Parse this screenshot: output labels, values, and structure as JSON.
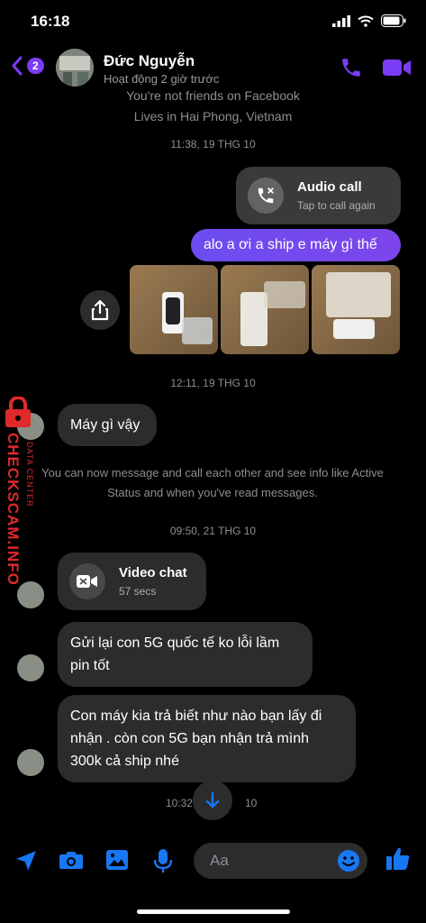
{
  "status": {
    "time": "16:18"
  },
  "header": {
    "back_badge": "2",
    "name": "Đức Nguyễn",
    "presence": "Hoạt động 2 giờ trước"
  },
  "profile_info": {
    "line1": "You're not friends on Facebook",
    "line2": "Lives in Hai Phong, Vietnam"
  },
  "timestamps": {
    "t1": "11:38, 19 THG 10",
    "t2": "12:11, 19 THG 10",
    "t3": "09:50, 21 THG 10",
    "t4": "10:32",
    "t4_suffix": "10"
  },
  "messages": {
    "audio_call_title": "Audio call",
    "audio_call_sub": "Tap to call again",
    "out_1": "alo a ơi a ship e máy gì thế",
    "in_1": "Máy gì vậy",
    "system_notice": "You can now message and call each other and see info like Active Status and when you've read messages.",
    "video_chat_title": "Video chat",
    "video_chat_sub": "57 secs",
    "in_2": "Gửi lại con 5G quốc tế ko lỗi lầm pin tốt",
    "in_3": "Con máy kia trả biết như nào bạn lấy đi nhận . còn con 5G bạn nhận trả mình 300k cả ship nhé"
  },
  "watermark": {
    "main": "CHECKSCAM.INFO",
    "small": "DATA CENTER"
  },
  "composer": {
    "placeholder": "Aa"
  },
  "colors": {
    "accent": "#7b3cf5",
    "composer_icons": "#1877f2"
  }
}
